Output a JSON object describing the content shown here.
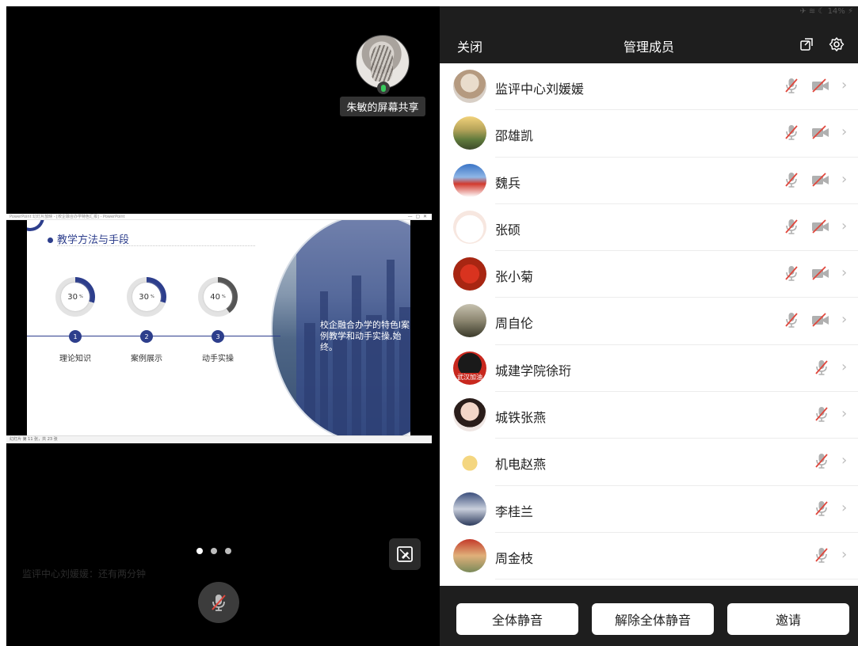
{
  "presenter": {
    "name": "朱敏的屏幕共享",
    "mic_icon": "mic-on-icon"
  },
  "slide": {
    "window_title": "PowerPoint 幻灯片放映 - [校企融合办学特色汇报] - PowerPoint",
    "heading": "教学方法与手段",
    "steps": [
      {
        "number": "1",
        "label": "理论知识",
        "percent": 30,
        "color": "#2d3e8c"
      },
      {
        "number": "2",
        "label": "案例展示",
        "percent": 30,
        "color": "#2d3e8c"
      },
      {
        "number": "3",
        "label": "动手实操",
        "percent": 40,
        "color": "#555555"
      }
    ],
    "percent_unit": "%",
    "side_text": "校企融合办学的特色l案例教学和动手实操,始终。",
    "status": "幻灯片 第 11 张，共 23 张"
  },
  "stage": {
    "chat_ghost": "监评中心刘媛媛：还有两分钟",
    "pager": {
      "count": 3,
      "active": 0
    }
  },
  "panel": {
    "statusbar": "✈ ≋ ☾ 14% ⚡",
    "close_label": "关闭",
    "title": "管理成员",
    "members": [
      {
        "name": "监评中心刘媛媛",
        "mic": "off",
        "camera": "off"
      },
      {
        "name": "邵雄凯",
        "mic": "off",
        "camera": "off"
      },
      {
        "name": "魏兵",
        "mic": "off",
        "camera": "off"
      },
      {
        "name": "张硕",
        "mic": "off",
        "camera": "off"
      },
      {
        "name": "张小菊",
        "mic": "off",
        "camera": "off"
      },
      {
        "name": "周自伦",
        "mic": "off",
        "camera": "off"
      },
      {
        "name": "城建学院徐珩",
        "mic": "off",
        "camera": "none",
        "avatar_text": "武汉加油"
      },
      {
        "name": "城铁张燕",
        "mic": "off",
        "camera": "none"
      },
      {
        "name": "机电赵燕",
        "mic": "off",
        "camera": "none"
      },
      {
        "name": "李桂兰",
        "mic": "off",
        "camera": "none"
      },
      {
        "name": "周金枝",
        "mic": "off",
        "camera": "none"
      }
    ],
    "buttons": {
      "mute_all": "全体静音",
      "unmute_all": "解除全体静音",
      "invite": "邀请"
    }
  },
  "colors": {
    "accent": "#2d3e8c",
    "muted_red": "#e0463c",
    "icon_grey": "#b0b0b0",
    "dark_bar": "#1e1e1e"
  }
}
